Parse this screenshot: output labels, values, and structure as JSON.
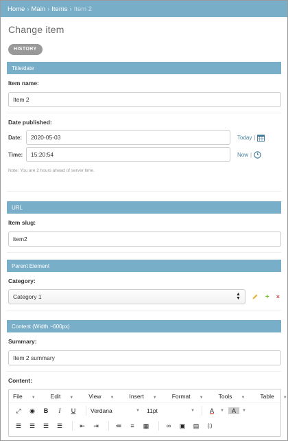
{
  "breadcrumbs": {
    "home": "Home",
    "sep": "›",
    "main": "Main",
    "items": "Items",
    "current": "Item 2"
  },
  "page_title": "Change item",
  "history_label": "HISTORY",
  "colors": {
    "header": "#79aec8",
    "link": "#447e9b",
    "edit": "#e8b02c",
    "add": "#70bf2b",
    "delete": "#dd4646"
  },
  "fieldsets": {
    "title_date": {
      "title": "Title/date",
      "item_name_label": "Item name:",
      "item_name_value": "Item 2",
      "date_published_label": "Date published:",
      "date_label": "Date:",
      "date_value": "2020-05-03",
      "today_link": "Today",
      "time_label": "Time:",
      "time_value": "15:20:54",
      "now_link": "Now",
      "link_sep": "|",
      "note": "Note: You are 2 hours ahead of server time."
    },
    "url": {
      "title": "URL",
      "slug_label": "Item slug:",
      "slug_value": "item2"
    },
    "parent": {
      "title": "Parent Element",
      "category_label": "Category:",
      "category_value": "Category 1",
      "add_symbol": "+",
      "delete_symbol": "×"
    },
    "content": {
      "title": "Content (Width ~600px)",
      "summary_label": "Summary:",
      "summary_value": "Item 2 summary",
      "content_label": "Content:"
    }
  },
  "editor": {
    "menus": [
      "File",
      "Edit",
      "View",
      "Insert",
      "Format",
      "Tools",
      "Table"
    ],
    "font_family": "Verdana",
    "font_size": "11pt",
    "icons": [
      "fullscreen-icon",
      "preview-icon",
      "bold-icon",
      "italic-icon",
      "underline-icon",
      "text-color-icon",
      "background-color-icon",
      "align-left-icon",
      "align-center-icon",
      "align-right-icon",
      "justify-icon",
      "outdent-icon",
      "indent-icon",
      "bullet-list-icon",
      "numbered-list-icon",
      "table-icon",
      "link-icon",
      "image-icon",
      "media-icon",
      "code-icon"
    ],
    "bold": "B",
    "italic": "I",
    "underline": "U",
    "text_color": "A",
    "code": "{;}"
  }
}
